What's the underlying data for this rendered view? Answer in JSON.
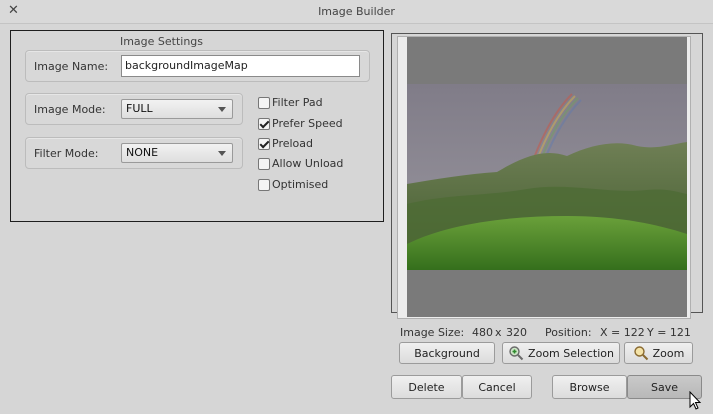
{
  "window": {
    "title": "Image Builder",
    "close_glyph": "✕"
  },
  "settings": {
    "panel_title": "Image Settings",
    "image_name": {
      "label": "Image Name:",
      "value": "backgroundImageMap"
    },
    "image_mode": {
      "label": "Image Mode:",
      "value": "FULL"
    },
    "filter_mode": {
      "label": "Filter Mode:",
      "value": "NONE"
    },
    "options": [
      {
        "label": "Filter Pad",
        "checked": false
      },
      {
        "label": "Prefer Speed",
        "checked": true
      },
      {
        "label": "Preload",
        "checked": true
      },
      {
        "label": "Allow Unload",
        "checked": false
      },
      {
        "label": "Optimised",
        "checked": false
      }
    ]
  },
  "preview": {
    "size_label": "Image Size:",
    "size_w": "480",
    "size_x": "x",
    "size_h": "320",
    "position_label": "Position:",
    "pos_x": "X = 122",
    "pos_y": "Y = 121",
    "buttons": {
      "background": "Background",
      "zoom_selection": "Zoom Selection",
      "zoom": "Zoom"
    }
  },
  "actions": {
    "delete": "Delete",
    "cancel": "Cancel",
    "browse": "Browse",
    "save": "Save"
  }
}
